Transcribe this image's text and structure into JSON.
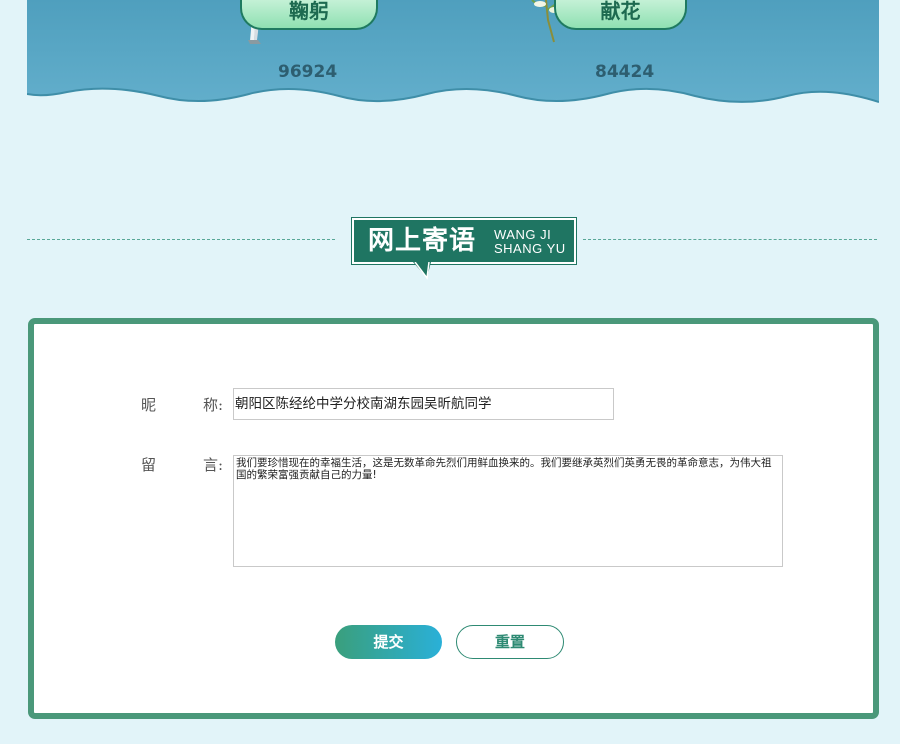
{
  "tribute": {
    "bow": {
      "label": "鞠躬",
      "count": "96924"
    },
    "flower": {
      "label": "献花",
      "count": "84424"
    }
  },
  "section": {
    "title_cn": "网上寄语",
    "title_en_line1": "WANG JI",
    "title_en_line2": "SHANG YU"
  },
  "form": {
    "nickname_label_1": "昵",
    "nickname_label_2": "称:",
    "nickname_value": "朝阳区陈经纶中学分校南湖东园吴昕航同学",
    "message_label_1": "留",
    "message_label_2": "言:",
    "message_value": "我们要珍惜现在的幸福生活，这是无数革命先烈们用鲜血换来的。我们要继承英烈们英勇无畏的革命意志，为伟大祖国的繁荣富强贡献自己的力量!",
    "submit_label": "提交",
    "reset_label": "重置"
  },
  "colors": {
    "page_bg": "#e2f4f9",
    "panel_blue": "#5aa8c4",
    "accent_green": "#1f7562",
    "card_border": "#4a987a"
  }
}
